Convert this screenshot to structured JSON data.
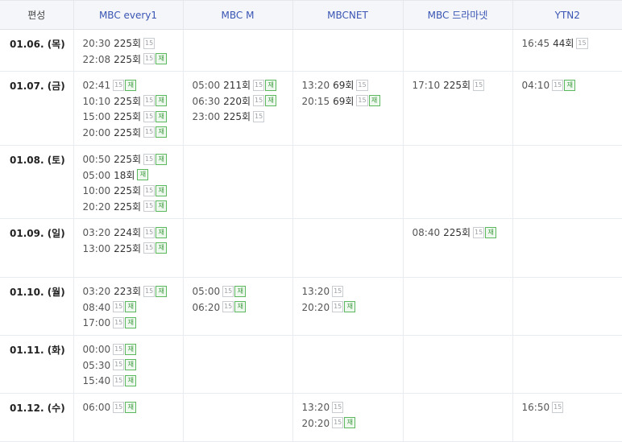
{
  "header": {
    "first": "편성",
    "channels": [
      "MBC every1",
      "MBC M",
      "MBCNET",
      "MBC 드라마넷",
      "YTN2"
    ]
  },
  "badges": {
    "rating": "15",
    "rerun": "재"
  },
  "rows": [
    {
      "date": "01.06. (목)",
      "cells": [
        [
          {
            "time": "20:30",
            "ep": "225회",
            "re": false
          },
          {
            "time": "22:08",
            "ep": "225회",
            "re": true
          }
        ],
        [],
        [],
        [],
        [
          {
            "time": "16:45",
            "ep": "44회",
            "re": false
          }
        ]
      ]
    },
    {
      "date": "01.07. (금)",
      "cells": [
        [
          {
            "time": "02:41",
            "ep": "",
            "re": true
          },
          {
            "time": "10:10",
            "ep": "225회",
            "re": true
          },
          {
            "time": "15:00",
            "ep": "225회",
            "re": true
          },
          {
            "time": "20:00",
            "ep": "225회",
            "re": true
          }
        ],
        [
          {
            "time": "05:00",
            "ep": "211회",
            "re": true
          },
          {
            "time": "06:30",
            "ep": "220회",
            "re": true
          },
          {
            "time": "23:00",
            "ep": "225회",
            "re": false
          }
        ],
        [
          {
            "time": "13:20",
            "ep": "69회",
            "re": false
          },
          {
            "time": "20:15",
            "ep": "69회",
            "re": true
          }
        ],
        [
          {
            "time": "17:10",
            "ep": "225회",
            "re": false
          }
        ],
        [
          {
            "time": "04:10",
            "ep": "",
            "re": true
          }
        ]
      ]
    },
    {
      "date": "01.08. (토)",
      "cells": [
        [
          {
            "time": "00:50",
            "ep": "225회",
            "re": true
          },
          {
            "time": "05:00",
            "ep": "18회",
            "re": true,
            "no15": true
          },
          {
            "time": "10:00",
            "ep": "225회",
            "re": true
          },
          {
            "time": "20:20",
            "ep": "225회",
            "re": true
          }
        ],
        [],
        [],
        [],
        []
      ]
    },
    {
      "date": "01.09. (일)",
      "cells": [
        [
          {
            "time": "03:20",
            "ep": "224회",
            "re": true
          },
          {
            "time": "13:00",
            "ep": "225회",
            "re": true
          }
        ],
        [],
        [],
        [
          {
            "time": "08:40",
            "ep": "225회",
            "re": true
          }
        ],
        []
      ]
    },
    {
      "date": "01.10. (월)",
      "cells": [
        [
          {
            "time": "03:20",
            "ep": "223회",
            "re": true
          },
          {
            "time": "08:40",
            "ep": "",
            "re": true
          },
          {
            "time": "17:00",
            "ep": "",
            "re": true
          }
        ],
        [
          {
            "time": "05:00",
            "ep": "",
            "re": true
          },
          {
            "time": "06:20",
            "ep": "",
            "re": true
          }
        ],
        [
          {
            "time": "13:20",
            "ep": "",
            "re": false
          },
          {
            "time": "20:20",
            "ep": "",
            "re": true
          }
        ],
        [],
        []
      ]
    },
    {
      "date": "01.11. (화)",
      "cells": [
        [
          {
            "time": "00:00",
            "ep": "",
            "re": true
          },
          {
            "time": "05:30",
            "ep": "",
            "re": true
          },
          {
            "time": "15:40",
            "ep": "",
            "re": true
          }
        ],
        [],
        [],
        [],
        []
      ]
    },
    {
      "date": "01.12. (수)",
      "cells": [
        [
          {
            "time": "06:00",
            "ep": "",
            "re": true
          }
        ],
        [],
        [
          {
            "time": "13:20",
            "ep": "",
            "re": false
          },
          {
            "time": "20:20",
            "ep": "",
            "re": true
          }
        ],
        [],
        [
          {
            "time": "16:50",
            "ep": "",
            "re": false
          }
        ]
      ]
    }
  ]
}
